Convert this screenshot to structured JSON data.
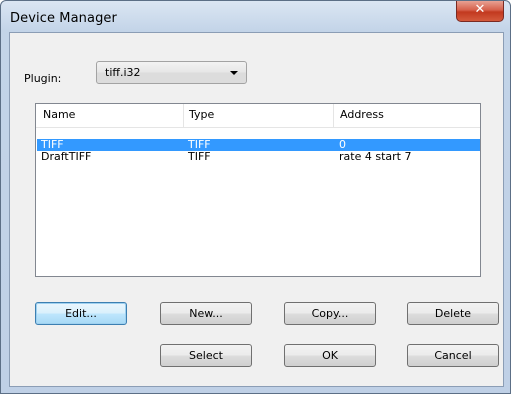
{
  "window": {
    "title": "Device Manager",
    "close_glyph": "✕"
  },
  "plugin": {
    "label": "Plugin:",
    "value": "tiff.i32"
  },
  "list": {
    "columns": [
      "Name",
      "Type",
      "Address"
    ],
    "rows": [
      {
        "name": "TIFF",
        "type": "TIFF",
        "address": "0",
        "selected": true
      },
      {
        "name": "DraftTIFF",
        "type": "TIFF",
        "address": "rate 4 start 7",
        "selected": false
      }
    ]
  },
  "buttons": {
    "edit": "Edit...",
    "new": "New...",
    "copy": "Copy...",
    "delete": "Delete",
    "select": "Select",
    "ok": "OK",
    "cancel": "Cancel"
  },
  "colors": {
    "selection": "#3399ff",
    "close_button": "#c2391f"
  },
  "icons": {
    "dropdown": "chevron-down-icon",
    "close": "close-icon"
  }
}
